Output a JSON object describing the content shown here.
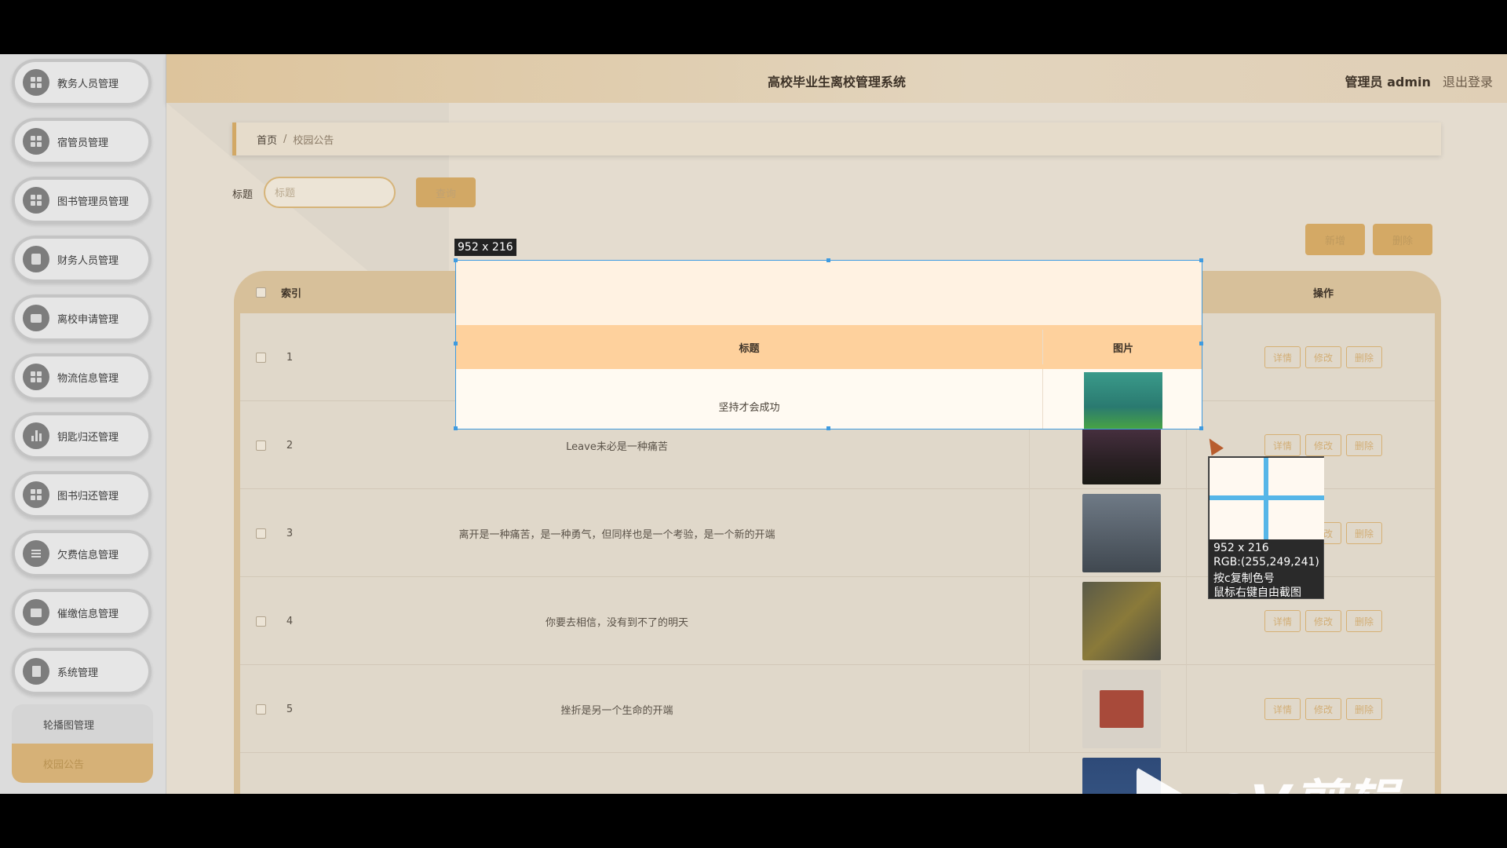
{
  "header": {
    "app_title": "高校毕业生离校管理系统",
    "user_role": "管理员 admin",
    "logout": "退出登录"
  },
  "sidebar": {
    "items": [
      {
        "label": "教务人员管理",
        "icon": "grid-icon"
      },
      {
        "label": "宿管员管理",
        "icon": "grid-icon"
      },
      {
        "label": "图书管理员管理",
        "icon": "grid-icon"
      },
      {
        "label": "财务人员管理",
        "icon": "clipboard-icon"
      },
      {
        "label": "离校申请管理",
        "icon": "briefcase-icon"
      },
      {
        "label": "物流信息管理",
        "icon": "grid-icon"
      },
      {
        "label": "钥匙归还管理",
        "icon": "bar-chart-icon"
      },
      {
        "label": "图书归还管理",
        "icon": "grid-icon"
      },
      {
        "label": "欠费信息管理",
        "icon": "list-icon"
      },
      {
        "label": "催缴信息管理",
        "icon": "monitor-icon"
      },
      {
        "label": "系统管理",
        "icon": "document-icon"
      }
    ],
    "sub_items": {
      "carousel": "轮播图管理",
      "notice": "校园公告"
    }
  },
  "breadcrumb": {
    "home": "首页",
    "separator": "/",
    "current": "校园公告"
  },
  "search": {
    "label": "标题",
    "placeholder": "标题",
    "button": "查询"
  },
  "toolbar": {
    "add": "新增",
    "delete": "删除"
  },
  "table": {
    "columns": {
      "index": "索引",
      "title": "标题",
      "image": "图片",
      "actions": "操作"
    },
    "rows": [
      {
        "index": "1",
        "title": "坚持才会成功"
      },
      {
        "index": "2",
        "title": "Leave未必是一种痛苦"
      },
      {
        "index": "3",
        "title": "离开是一种痛苦，是一种勇气，但同样也是一个考验，是一个新的开端"
      },
      {
        "index": "4",
        "title": "你要去相信，没有到不了的明天"
      },
      {
        "index": "5",
        "title": "挫折是另一个生命的开端"
      }
    ],
    "row_actions": {
      "detail": "详情",
      "edit": "修改",
      "delete": "删除"
    }
  },
  "screenshot_tool": {
    "selection_size": "952 x 216",
    "magnifier": {
      "size": "952 x 216",
      "rgb": "RGB:(255,249,241)",
      "hint_copy": "按c复制色号",
      "hint_free": "鼠标右键自由截图"
    }
  },
  "watermark": {
    "text": "eV剪辑"
  },
  "colors": {
    "accent": "#d4a965",
    "header_row": "#fed19d",
    "selection_border": "#3f9be0"
  }
}
